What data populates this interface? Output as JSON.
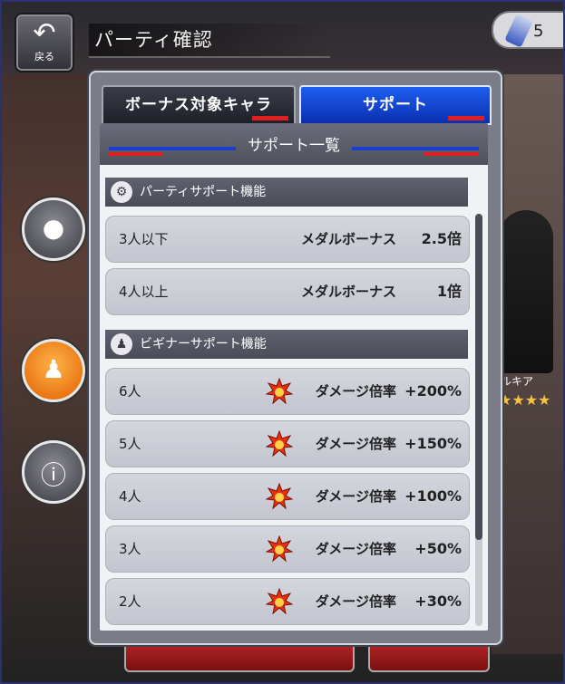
{
  "header": {
    "back_label": "戻る",
    "title": "パーティ確認",
    "pill_value": "5"
  },
  "tabs": [
    {
      "label": "ボーナス対象キャラ",
      "active": false
    },
    {
      "label": "サポート",
      "active": true
    }
  ],
  "panel": {
    "title": "サポート一覧",
    "party_section": {
      "label": "パーティサポート機能",
      "rows": [
        {
          "condition": "3人以下",
          "type": "メダルボーナス",
          "value": "2.5倍"
        },
        {
          "condition": "4人以上",
          "type": "メダルボーナス",
          "value": "1倍"
        }
      ]
    },
    "beginner_section": {
      "label": "ビギナーサポート機能",
      "rows": [
        {
          "condition": "6人",
          "type": "ダメージ倍率",
          "value": "+200%"
        },
        {
          "condition": "5人",
          "type": "ダメージ倍率",
          "value": "+150%"
        },
        {
          "condition": "4人",
          "type": "ダメージ倍率",
          "value": "+100%"
        },
        {
          "condition": "3人",
          "type": "ダメージ倍率",
          "value": "+50%"
        },
        {
          "condition": "2人",
          "type": "ダメージ倍率",
          "value": "+30%"
        }
      ]
    }
  },
  "background": {
    "char_name_partial": "ルキア",
    "star_rating": "★★★★"
  },
  "colors": {
    "tab_active": "#1f5ff0",
    "accent_red": "#e02020",
    "accent_blue": "#1a3fd0"
  }
}
